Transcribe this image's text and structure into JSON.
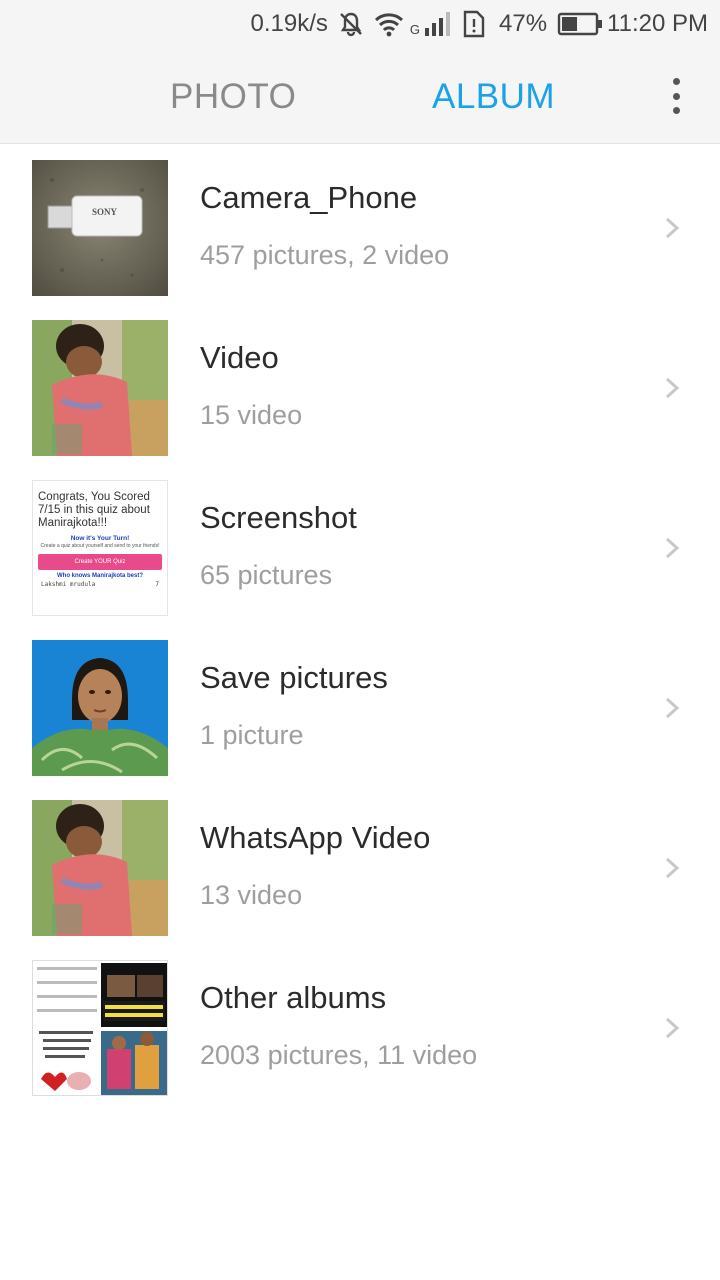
{
  "status_bar": {
    "net_speed": "0.19k/s",
    "battery_percent": "47%",
    "time": "11:20 PM",
    "network_type": "G",
    "battery_level": 0.47,
    "icons": [
      "mute-bell-icon",
      "wifi-icon",
      "signal-icon",
      "sim-icon",
      "battery-icon"
    ]
  },
  "header": {
    "tabs": [
      {
        "label": "PHOTO",
        "active": false
      },
      {
        "label": "ALBUM",
        "active": true
      }
    ],
    "active_color": "#1aa3e8",
    "inactive_color": "#8a8a8a"
  },
  "albums": [
    {
      "name": "Camera_Phone",
      "count": "457 pictures, 2 video",
      "thumb": "usb-drive-photo"
    },
    {
      "name": "Video",
      "count": "15 video",
      "thumb": "child-photo"
    },
    {
      "name": "Screenshot",
      "count": "65 pictures",
      "thumb": "quiz-screenshot",
      "thumb_text": {
        "title": "Congrats, You Scored 7/15 in this quiz about Manirajkota!!!",
        "turn": "Now it's Your Turn!",
        "sub": "Create a quiz about yourself and send to your friends!",
        "button": "Create YOUR Quiz",
        "who": "Who knows Manirajkota best?",
        "row_name": "Lakshmi mrudula",
        "row_score": "7"
      }
    },
    {
      "name": "Save pictures",
      "count": "1 picture",
      "thumb": "portrait-photo"
    },
    {
      "name": "WhatsApp Video",
      "count": "13 video",
      "thumb": "child-photo"
    },
    {
      "name": "Other albums",
      "count": "2003 pictures, 11 video",
      "thumb": "collage-photo"
    }
  ]
}
